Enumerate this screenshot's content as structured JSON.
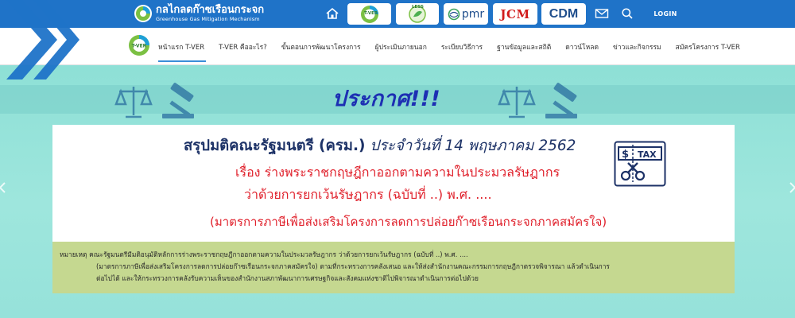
{
  "header": {
    "brand_th": "กลไกลดก๊าซเรือนกระจก",
    "brand_en": "Greenhouse Gas Mitigation Mechanism",
    "logos": {
      "tver": "T-VER",
      "less": "LESS",
      "pmr": "pmr",
      "jcm": "JCM",
      "cdm": "CDM"
    },
    "login_label": "LOGIN"
  },
  "nav": {
    "logo_label": "T-VER",
    "items": [
      {
        "label": "หน้าแรก T-VER"
      },
      {
        "label": "T-VER คืออะไร?"
      },
      {
        "label": "ขั้นตอนการพัฒนาโครงการ"
      },
      {
        "label": "ผู้ประเมินภายนอก"
      },
      {
        "label": "ระเบียบวิธีการ"
      },
      {
        "label": "ฐานข้อมูลและสถิติ"
      },
      {
        "label": "ดาวน์โหลด"
      },
      {
        "label": "ข่าวและกิจกรรม"
      },
      {
        "label": "สมัครโครงการ T-VER"
      }
    ]
  },
  "banner": {
    "announcement": "ประกาศ!!!",
    "title_bold": "สรุปมติคณะรัฐมนตรี (ครม.)",
    "title_italic": "ประจำวันที่ 14 พฤษภาคม 2562",
    "line1": "เรื่อง ร่างพระราชกฤษฎีกาออกตามความในประมวลรัษฎากร",
    "line2": "ว่าด้วยการยกเว้นรัษฎากร (ฉบับที่ ..) พ.ศ. ....",
    "line3": "(มาตรการภาษีเพื่อส่งเสริมโครงการลดการปล่อยก๊าซเรือนกระจกภาคสมัครใจ)",
    "tax_label": "TAX",
    "note": {
      "line1": "หมายเหตุ คณะรัฐมนตรีมีมติอนุมัติหลักการร่างพระราชกฤษฎีกาออกตามความในประมวลรัษฎากร ว่าด้วยการยกเว้นรัษฎากร (ฉบับที่ ..) พ.ศ. ....",
      "line2": "(มาตรการภาษีเพื่อส่งเสริมโครงการลดการปล่อยก๊าซเรือนกระจกภาคสมัครใจ) ตามที่กระทรวงการคลังเสนอ และให้ส่งสำนักงานคณะกรรมการกฤษฎีกาตรวจพิจารณา แล้วดำเนินการ",
      "line3": "ต่อไปได้ และให้กระทรวงการคลังรับความเห็นของสำนักงานสภาพัฒนาการเศรษฐกิจและสังคมแห่งชาติไปพิจารณาดำเนินการต่อไปด้วย"
    }
  },
  "colors": {
    "header_bg": "#1f73c8",
    "banner_bg": "#8fe0d8",
    "title_blue": "#1d3267",
    "accent_red": "#e0202b",
    "announce_blue": "#1d2fb3",
    "note_bg": "#c5d890"
  }
}
